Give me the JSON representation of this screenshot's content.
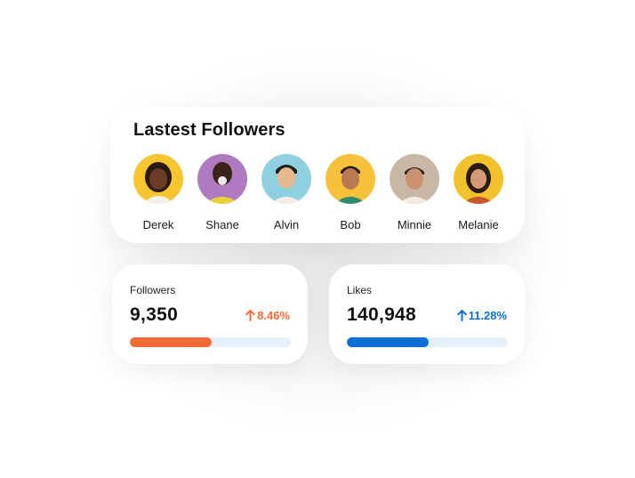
{
  "followers_card": {
    "title": "Lastest Followers",
    "followers": [
      {
        "name": "Derek",
        "bg": "#f7c530"
      },
      {
        "name": "Shane",
        "bg": "#b07ac0"
      },
      {
        "name": "Alvin",
        "bg": "#8fd0e0"
      },
      {
        "name": "Bob",
        "bg": "#f7c13a"
      },
      {
        "name": "Minnie",
        "bg": "#c9b7a6"
      },
      {
        "name": "Melanie",
        "bg": "#f2c22c"
      }
    ]
  },
  "stats": {
    "followers": {
      "label": "Followers",
      "value": "9,350",
      "change": "8.46%",
      "color": "#f46a35",
      "progress": 0.51
    },
    "likes": {
      "label": "Likes",
      "value": "140,948",
      "change": "11.28%",
      "color": "#0b6fd6",
      "progress": 0.51
    }
  },
  "colors": {
    "track": "#e6f0fb"
  },
  "icons": {
    "change_arrow": "arrow-up-icon"
  }
}
